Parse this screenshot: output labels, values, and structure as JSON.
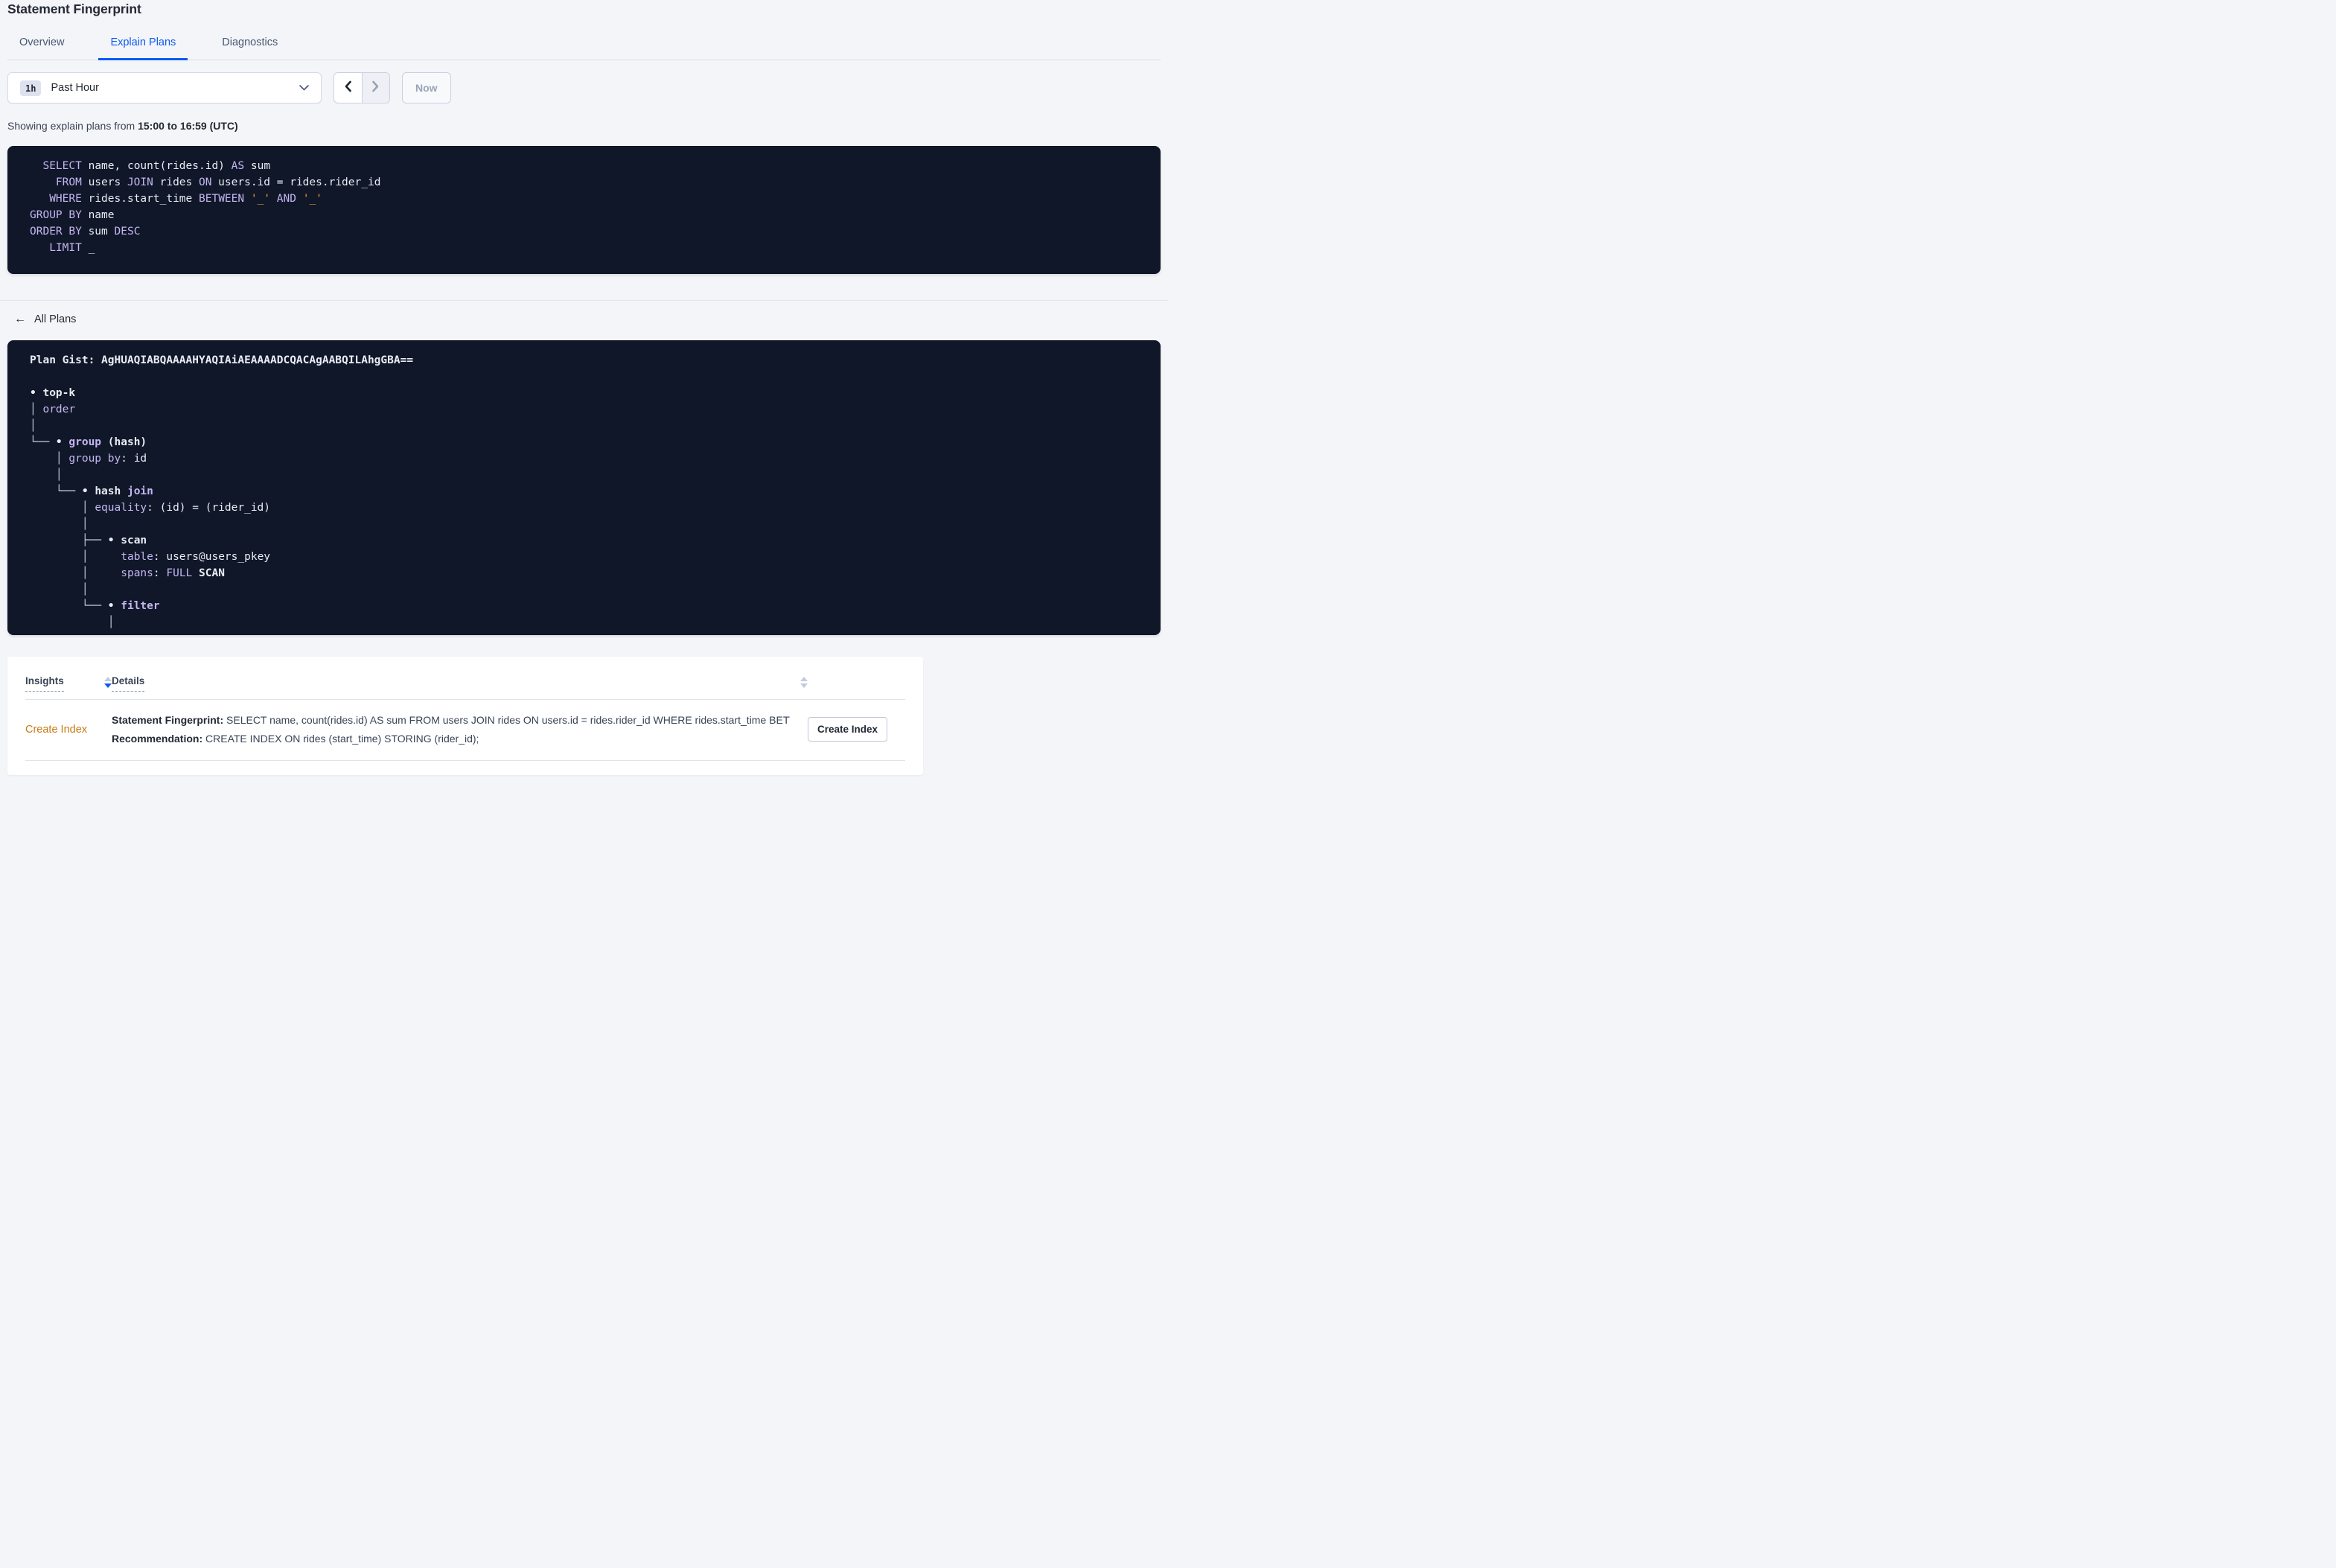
{
  "page": {
    "title": "Statement Fingerprint"
  },
  "colors": {
    "accent_blue": "#0b5bf2",
    "code_background": "#0f1729",
    "code_keyword": "#c5b5f0",
    "code_literal_orange": "#f2a33c",
    "insight_link_orange": "#c87a13"
  },
  "icons": {
    "back_arrow": "←"
  },
  "tabs": [
    {
      "label": "Overview",
      "active": false
    },
    {
      "label": "Explain Plans",
      "active": true
    },
    {
      "label": "Diagnostics",
      "active": false
    }
  ],
  "time_picker": {
    "badge": "1h",
    "label": "Past Hour",
    "now_label": "Now"
  },
  "subtitle": {
    "prefix": "Showing explain plans from ",
    "range": "15:00 to 16:59 (UTC)"
  },
  "sql": {
    "lines": [
      [
        {
          "t": "  "
        },
        {
          "t": "SELECT",
          "c": "kw"
        },
        {
          "t": " name, count(rides.id) "
        },
        {
          "t": "AS",
          "c": "kw"
        },
        {
          "t": " sum"
        }
      ],
      [
        {
          "t": "    "
        },
        {
          "t": "FROM",
          "c": "kw"
        },
        {
          "t": " users "
        },
        {
          "t": "JOIN",
          "c": "kw"
        },
        {
          "t": " rides "
        },
        {
          "t": "ON",
          "c": "kw"
        },
        {
          "t": " users.id = rides.rider_id"
        }
      ],
      [
        {
          "t": "   "
        },
        {
          "t": "WHERE",
          "c": "kw"
        },
        {
          "t": " rides.start_time "
        },
        {
          "t": "BETWEEN",
          "c": "kw"
        },
        {
          "t": " "
        },
        {
          "t": "'_'",
          "c": "num"
        },
        {
          "t": " "
        },
        {
          "t": "AND",
          "c": "kw"
        },
        {
          "t": " "
        },
        {
          "t": "'_'",
          "c": "num"
        }
      ],
      [
        {
          "t": "GROUP BY",
          "c": "kw"
        },
        {
          "t": " name"
        }
      ],
      [
        {
          "t": "ORDER BY",
          "c": "kw"
        },
        {
          "t": " sum "
        },
        {
          "t": "DESC",
          "c": "kw"
        }
      ],
      [
        {
          "t": "   "
        },
        {
          "t": "LIMIT",
          "c": "kw"
        },
        {
          "t": " _"
        }
      ]
    ]
  },
  "back_link": {
    "label": "All Plans"
  },
  "plan": {
    "gist_label": "Plan Gist:",
    "gist": "AgHUAQIABQAAAAHYAQIAiAEAAAADCQACAgAABQILAhgGBA==",
    "lines": [
      [
        {
          "t": "Plan Gist: AgHUAQIABQAAAAHYAQIAiAEAAAADCQACAgAABQILAhgGBA==",
          "c": "b"
        }
      ],
      [
        {
          "t": ""
        }
      ],
      [
        {
          "t": "• ",
          "c": "b"
        },
        {
          "t": "top-k",
          "c": "b"
        }
      ],
      [
        {
          "t": "│ ",
          "c": "tree"
        },
        {
          "t": "order",
          "c": "kw"
        }
      ],
      [
        {
          "t": "│",
          "c": "tree"
        }
      ],
      [
        {
          "t": "└── ",
          "c": "tree"
        },
        {
          "t": "• ",
          "c": "b"
        },
        {
          "t": "group",
          "c": "kwb"
        },
        {
          "t": " (hash)",
          "c": "b"
        }
      ],
      [
        {
          "t": "    "
        },
        {
          "t": "│ ",
          "c": "tree"
        },
        {
          "t": "group by",
          "c": "kw"
        },
        {
          "t": ": id"
        }
      ],
      [
        {
          "t": "    "
        },
        {
          "t": "│",
          "c": "tree"
        }
      ],
      [
        {
          "t": "    "
        },
        {
          "t": "└── ",
          "c": "tree"
        },
        {
          "t": "• ",
          "c": "b"
        },
        {
          "t": "hash",
          "c": "b"
        },
        {
          "t": " "
        },
        {
          "t": "join",
          "c": "kwb"
        }
      ],
      [
        {
          "t": "        "
        },
        {
          "t": "│ ",
          "c": "tree"
        },
        {
          "t": "equality",
          "c": "kw"
        },
        {
          "t": ": (id) = (rider_id)"
        }
      ],
      [
        {
          "t": "        "
        },
        {
          "t": "│",
          "c": "tree"
        }
      ],
      [
        {
          "t": "        "
        },
        {
          "t": "├── ",
          "c": "tree"
        },
        {
          "t": "• ",
          "c": "b"
        },
        {
          "t": "scan",
          "c": "b"
        }
      ],
      [
        {
          "t": "        "
        },
        {
          "t": "│     ",
          "c": "tree"
        },
        {
          "t": "table",
          "c": "kw"
        },
        {
          "t": ": users@users_pkey"
        }
      ],
      [
        {
          "t": "        "
        },
        {
          "t": "│     ",
          "c": "tree"
        },
        {
          "t": "spans",
          "c": "kw"
        },
        {
          "t": ": "
        },
        {
          "t": "FULL",
          "c": "kw"
        },
        {
          "t": " "
        },
        {
          "t": "SCAN",
          "c": "b"
        }
      ],
      [
        {
          "t": "        "
        },
        {
          "t": "│",
          "c": "tree"
        }
      ],
      [
        {
          "t": "        "
        },
        {
          "t": "└── ",
          "c": "tree"
        },
        {
          "t": "• ",
          "c": "b"
        },
        {
          "t": "filter",
          "c": "kwb"
        }
      ],
      [
        {
          "t": "            "
        },
        {
          "t": "│",
          "c": "tree"
        }
      ]
    ]
  },
  "insights_table": {
    "columns": [
      "Insights",
      "Details"
    ],
    "rows": [
      {
        "insight": "Create Index",
        "statement_label": "Statement Fingerprint:",
        "statement": "SELECT name, count(rides.id) AS sum FROM users JOIN rides ON users.id = rides.rider_id WHERE rides.start_time BETWEEN '_…",
        "recommendation_label": "Recommendation:",
        "recommendation": "CREATE INDEX ON rides (start_time) STORING (rider_id);",
        "action": "Create Index"
      }
    ]
  }
}
